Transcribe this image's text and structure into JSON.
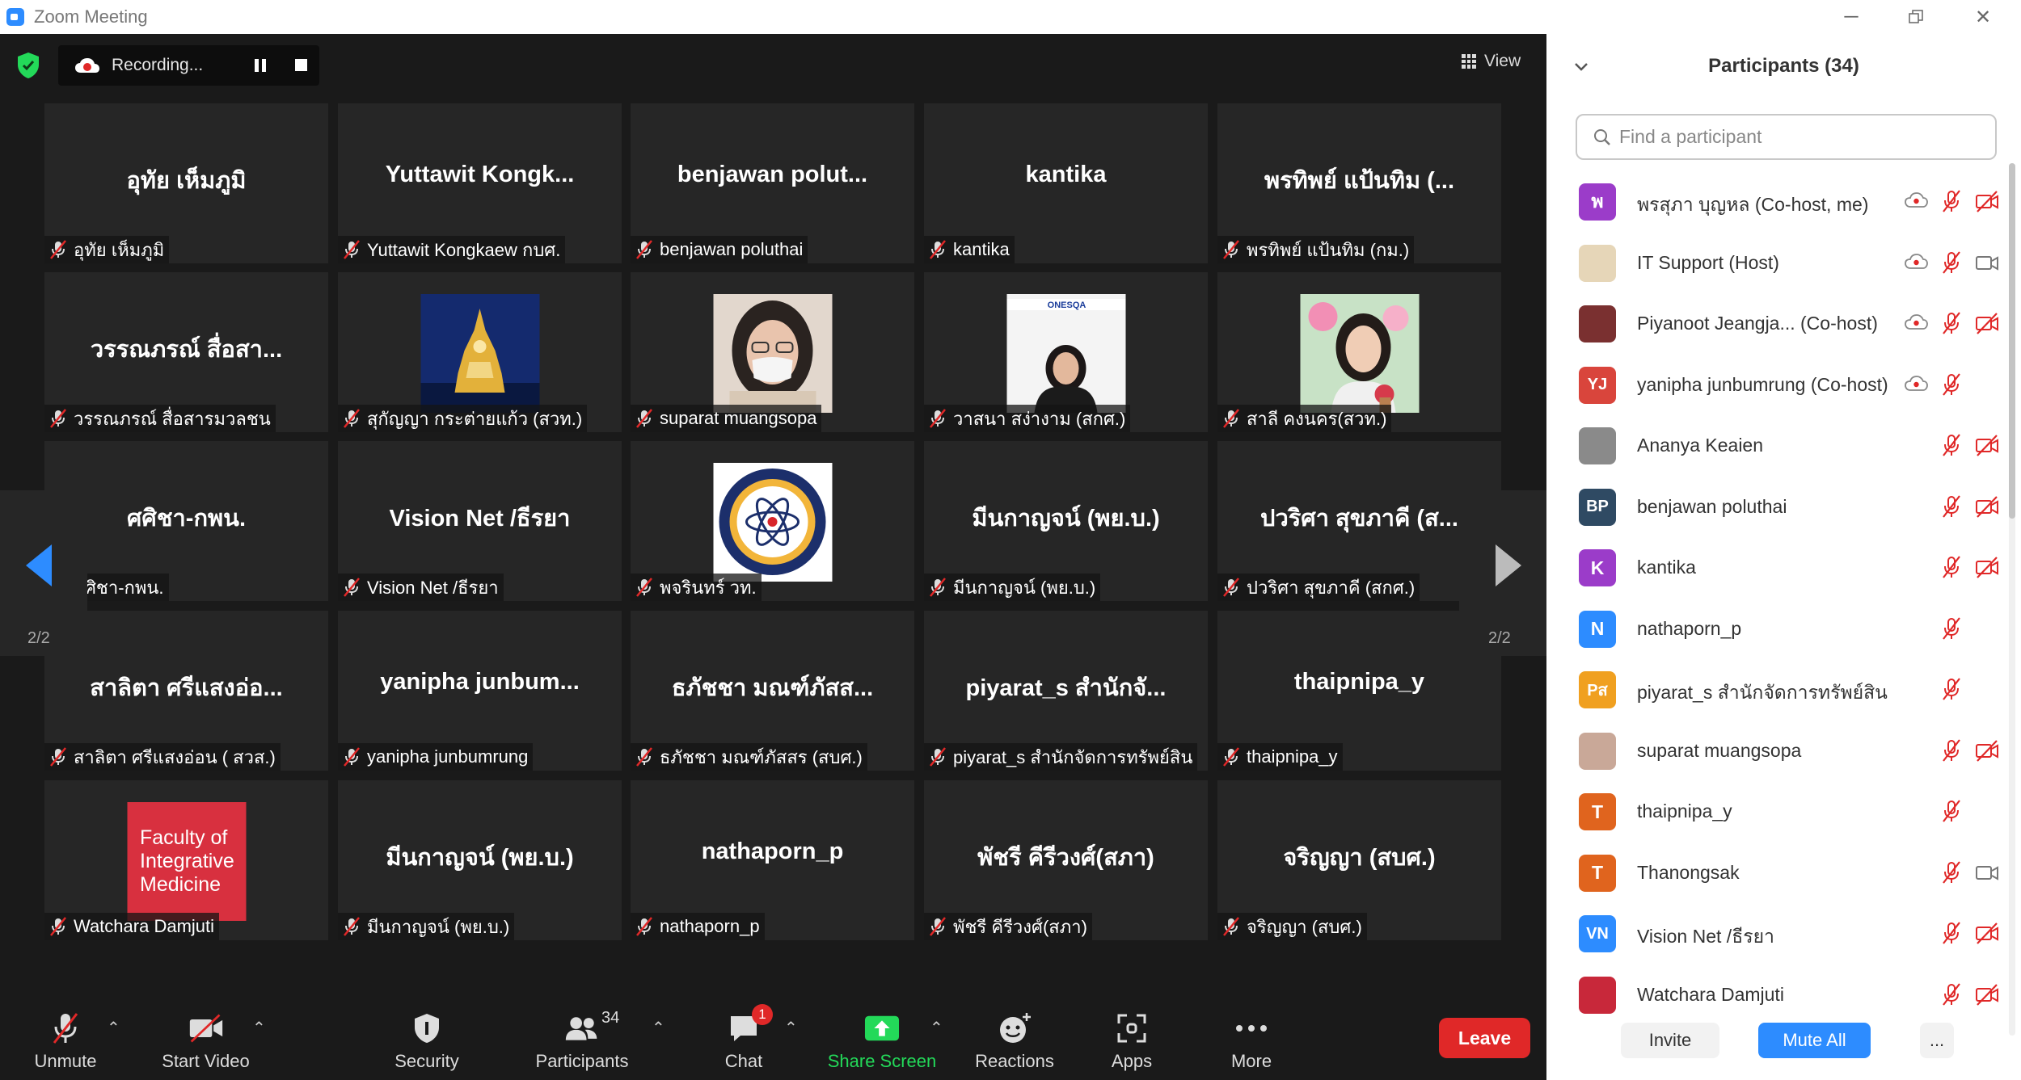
{
  "window": {
    "title": "Zoom Meeting",
    "controls": [
      "minimize",
      "restore",
      "close"
    ]
  },
  "meeting": {
    "recording_label": "Recording...",
    "view_label": "View",
    "page_indicator": "2/2"
  },
  "tiles": [
    {
      "big": "อุทัย เห็มภูมิ",
      "caption": "อุทัย เห็มภูมิ"
    },
    {
      "big": "Yuttawit  Kongk...",
      "caption": "Yuttawit Kongkaew กบศ."
    },
    {
      "big": "benjawan  polut...",
      "caption": "benjawan poluthai"
    },
    {
      "big": "kantika",
      "caption": "kantika"
    },
    {
      "big": "พรทิพย์ แป้นทิม (...",
      "caption": "พรทิพย์ แป้นทิม (กม.)"
    },
    {
      "big": "วรรณภรณ์ สื่อสา...",
      "caption": "วรรณภรณ์ สื่อสารมวลชน"
    },
    {
      "big": "",
      "caption": "สุกัญญา กระต่ายแก้ว (สวท.)",
      "photo": "temple"
    },
    {
      "big": "",
      "caption": "suparat muangsopa",
      "photo": "woman-mask"
    },
    {
      "big": "",
      "caption": "วาสนา สง่างาม (สกศ.)",
      "photo": "woman-office"
    },
    {
      "big": "",
      "caption": "สาลี คงนคร(สวท.)",
      "photo": "woman-flowers"
    },
    {
      "big": "ศศิชา-กพน.",
      "caption": "ศศิชา-กพน."
    },
    {
      "big": "Vision Net /ธีรยา",
      "caption": "Vision Net /ธีรยา"
    },
    {
      "big": "",
      "caption": "พจรินทร์ วท.",
      "photo": "logo-seal"
    },
    {
      "big": "มีนกาญจน์ (พย.บ.)",
      "caption": "มีนกาญจน์ (พย.บ.)"
    },
    {
      "big": "ปวริศา สุขภาคี (ส...",
      "caption": "ปวริศา สุขภาคี (สกศ.)"
    },
    {
      "big": "สาลิตา  ศรีแสงอ่อ...",
      "caption": "สาลิตา  ศรีแสงอ่อน ( สวส.)"
    },
    {
      "big": "yanipha  junbum...",
      "caption": "yanipha junbumrung"
    },
    {
      "big": "ธภัชชา มณฑ์ภัสส...",
      "caption": "ธภัชชา มณฑ์ภัสสร (สบศ.)"
    },
    {
      "big": "piyarat_s สำนักจั...",
      "caption": "piyarat_s สำนักจัดการทรัพย์สิน"
    },
    {
      "big": "thaipnipa_y",
      "caption": "thaipnipa_y"
    },
    {
      "big": "",
      "caption": "Watchara Damjuti",
      "photo": "faculty-logo",
      "photo_text": [
        "Faculty of",
        "Integrative",
        "Medicine"
      ]
    },
    {
      "big": "มีนกาญจน์ (พย.บ.)",
      "caption": "มีนกาญจน์ (พย.บ.)"
    },
    {
      "big": "nathaporn_p",
      "caption": "nathaporn_p"
    },
    {
      "big": "พัชรี คีรีวงศ์(สภา)",
      "caption": "พัชรี คีรีวงศ์(สภา)"
    },
    {
      "big": "จริญญา (สบศ.)",
      "caption": "จริญญา (สบศ.)"
    }
  ],
  "toolbar": {
    "unmute": "Unmute",
    "start_video": "Start Video",
    "security": "Security",
    "participants": "Participants",
    "participants_count": "34",
    "chat": "Chat",
    "chat_badge": "1",
    "share_screen": "Share Screen",
    "reactions": "Reactions",
    "apps": "Apps",
    "more": "More",
    "leave": "Leave"
  },
  "panel": {
    "title": "Participants (34)",
    "search_placeholder": "Find a participant",
    "invite": "Invite",
    "mute_all": "Mute All",
    "more": "...",
    "participants": [
      {
        "initials": "พ",
        "color": "#9b3cc9",
        "name": "พรสุภา บุญหล (Co-host, me)",
        "rec": true,
        "video": "off"
      },
      {
        "initials": "",
        "color": "#e6d6b8",
        "name": "IT Support (Host)",
        "rec": true,
        "video": "on"
      },
      {
        "initials": "",
        "color": "#7a3030",
        "name": "Piyanoot Jeangja... (Co-host)",
        "rec": true,
        "video": "off"
      },
      {
        "initials": "YJ",
        "color": "#d9453c",
        "name": "yanipha junbumrung (Co-host)",
        "rec": true,
        "video": "none"
      },
      {
        "initials": "",
        "color": "#8a8a8a",
        "name": "Ananya Keaien",
        "rec": false,
        "video": "off"
      },
      {
        "initials": "BP",
        "color": "#2f4a63",
        "name": "benjawan poluthai",
        "rec": false,
        "video": "off"
      },
      {
        "initials": "K",
        "color": "#9b3cc9",
        "name": "kantika",
        "rec": false,
        "video": "off"
      },
      {
        "initials": "N",
        "color": "#2d8cff",
        "name": "nathaporn_p",
        "rec": false,
        "video": "none"
      },
      {
        "initials": "Pส",
        "color": "#f0a020",
        "name": "piyarat_s สำนักจัดการทรัพย์สิน",
        "rec": false,
        "video": "none"
      },
      {
        "initials": "",
        "color": "#c9a898",
        "name": "suparat muangsopa",
        "rec": false,
        "video": "off"
      },
      {
        "initials": "T",
        "color": "#e0641e",
        "name": "thaipnipa_y",
        "rec": false,
        "video": "none"
      },
      {
        "initials": "T",
        "color": "#e0641e",
        "name": "Thanongsak",
        "rec": false,
        "video": "on"
      },
      {
        "initials": "VN",
        "color": "#2d8cff",
        "name": "Vision Net /ธีรยา",
        "rec": false,
        "video": "off"
      },
      {
        "initials": "",
        "color": "#c8283a",
        "name": "Watchara Damjuti",
        "rec": false,
        "video": "off"
      }
    ]
  }
}
